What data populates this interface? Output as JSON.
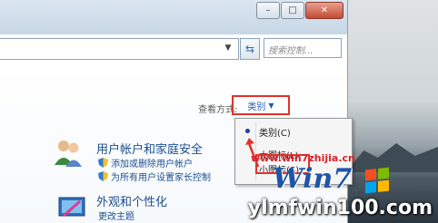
{
  "window": {
    "caption": {
      "minimize": "–",
      "maximize": "□",
      "close": "✕"
    }
  },
  "toolbar": {
    "search_placeholder": "搜索控制...",
    "refresh_icon": "refresh-icon"
  },
  "view": {
    "label": "查看方式:",
    "current": "类别",
    "menu": [
      {
        "label": "类别(C)",
        "selected": true
      },
      {
        "label": "大图标(L)",
        "selected": false
      },
      {
        "label": "小图标(S)",
        "selected": false
      }
    ]
  },
  "sections": [
    {
      "title": "用户帐户和家庭安全",
      "links": [
        "添加或删除用户帐户",
        "为所有用户设置家长控制"
      ]
    },
    {
      "title": "外观和个性化",
      "links": [
        "更改主题"
      ]
    }
  ],
  "watermark": {
    "site": "www.win7zhijia.cn",
    "brand": "Win7",
    "bottom": "ylmfwin100.com"
  },
  "colors": {
    "highlight": "#e0322c",
    "link": "#1c4e8f"
  }
}
